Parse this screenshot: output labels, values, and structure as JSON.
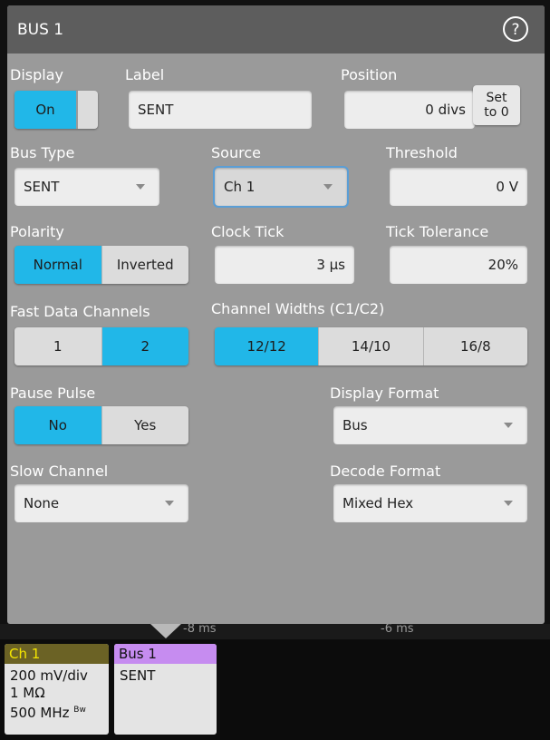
{
  "dialog": {
    "title": "BUS 1",
    "help_icon": "help-circle-icon"
  },
  "display": {
    "label": "Display",
    "on": "On",
    "state": "on"
  },
  "label_field": {
    "label": "Label",
    "value": "SENT"
  },
  "position": {
    "label": "Position",
    "value": "0 divs",
    "set_to_zero": "Set to 0"
  },
  "bus_type": {
    "label": "Bus Type",
    "value": "SENT"
  },
  "source": {
    "label": "Source",
    "value": "Ch 1"
  },
  "threshold": {
    "label": "Threshold",
    "value": "0 V"
  },
  "polarity": {
    "label": "Polarity",
    "options": [
      "Normal",
      "Inverted"
    ],
    "selected": "Normal"
  },
  "clock_tick": {
    "label": "Clock Tick",
    "value": "3 µs"
  },
  "tick_tolerance": {
    "label": "Tick Tolerance",
    "value": "20%"
  },
  "fast_data_channels": {
    "label": "Fast Data Channels",
    "options": [
      "1",
      "2"
    ],
    "selected": "2"
  },
  "channel_widths": {
    "label": "Channel Widths (C1/C2)",
    "options": [
      "12/12",
      "14/10",
      "16/8"
    ],
    "selected": "12/12"
  },
  "pause_pulse": {
    "label": "Pause Pulse",
    "options": [
      "No",
      "Yes"
    ],
    "selected": "No"
  },
  "display_format": {
    "label": "Display Format",
    "value": "Bus"
  },
  "slow_channel": {
    "label": "Slow Channel",
    "value": "None"
  },
  "decode_format": {
    "label": "Decode Format",
    "value": "Mixed Hex"
  },
  "time_scale": {
    "left": "-8 ms",
    "right": "-6 ms"
  },
  "ch1_badge": {
    "title": "Ch 1",
    "scale": "200 mV/div",
    "impedance": "1 MΩ",
    "bandwidth": "500 MHz",
    "bw_mark": "Bw",
    "color": "#f4e600"
  },
  "bus1_badge": {
    "title": "Bus 1",
    "protocol": "SENT",
    "color": "#c68cf0"
  },
  "colors": {
    "accent": "#21b7e8",
    "panel": "#9a9a9a",
    "header": "#5d5d5d"
  }
}
